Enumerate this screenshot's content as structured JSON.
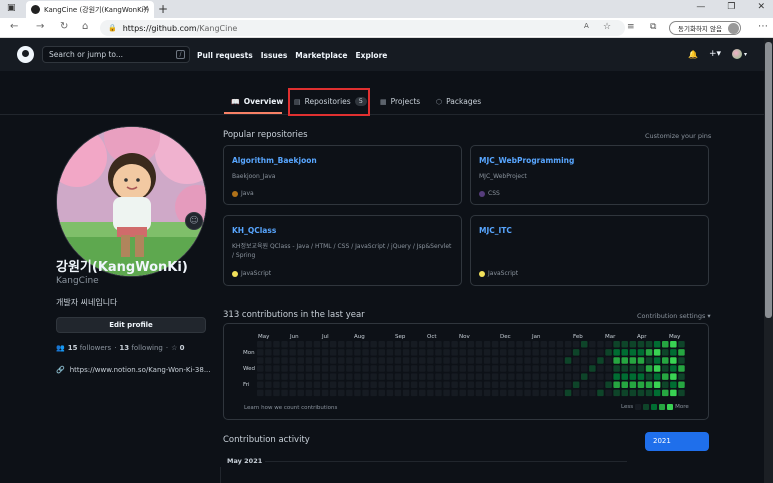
{
  "browser": {
    "tab_title": "KangCine (강원기(KangWonKi))",
    "tab_close": "✕",
    "new_tab": "+",
    "window_controls": [
      "—",
      "❐",
      "✕"
    ],
    "url_host": "https://github.com",
    "url_path": "/KangCine",
    "sync_label": "동기화하지 않음"
  },
  "header": {
    "search_placeholder": "Search or jump to...",
    "search_key": "/",
    "nav": [
      "Pull requests",
      "Issues",
      "Marketplace",
      "Explore"
    ],
    "bell_icon": "🔔",
    "plus_label": "+▾"
  },
  "profile_tabs": {
    "overview": "Overview",
    "repositories": "Repositories",
    "repositories_count": "5",
    "projects": "Projects",
    "packages": "Packages"
  },
  "profile": {
    "name": "강원기(KangWonKi)",
    "login": "KangCine",
    "bio": "개발자 씨네입니다",
    "edit_label": "Edit profile",
    "followers_count": "15",
    "followers_label": "followers",
    "following_count": "13",
    "following_label": "following",
    "stars_count": "0",
    "website": "https://www.notion.so/Kang-Won-Ki-38..."
  },
  "popular": {
    "title": "Popular repositories",
    "customize": "Customize your pins",
    "repos": [
      {
        "name": "Algorithm_Baekjoon",
        "desc": "Baekjoon_Java",
        "lang": "Java",
        "color": "#b07219"
      },
      {
        "name": "MJC_WebProgramming",
        "desc": "MJC_WebProject",
        "lang": "CSS",
        "color": "#563d7c"
      },
      {
        "name": "KH_QClass",
        "desc": "KH정보교육원 QClass - Java / HTML / CSS / JavaScript / jQuery / Jsp&Servlet / Spring",
        "lang": "JavaScript",
        "color": "#f1e05a"
      },
      {
        "name": "MJC_ITC",
        "desc": "",
        "lang": "JavaScript",
        "color": "#f1e05a"
      }
    ]
  },
  "contributions": {
    "title": "313 contributions in the last year",
    "settings": "Contribution settings ▾",
    "months": [
      "May",
      "Jun",
      "Jul",
      "Aug",
      "Sep",
      "Oct",
      "Nov",
      "Dec",
      "Jan",
      "Feb",
      "Mar",
      "Apr",
      "May"
    ],
    "weekdays": [
      "Mon",
      "Wed",
      "Fri"
    ],
    "learn": "Learn how we count contributions",
    "less": "Less",
    "more": "More",
    "levels": [
      "#161b22",
      "#0e4429",
      "#006d32",
      "#26a641",
      "#39d353"
    ]
  },
  "activity": {
    "title": "Contribution activity",
    "year": "2021",
    "month": "May 2021"
  }
}
